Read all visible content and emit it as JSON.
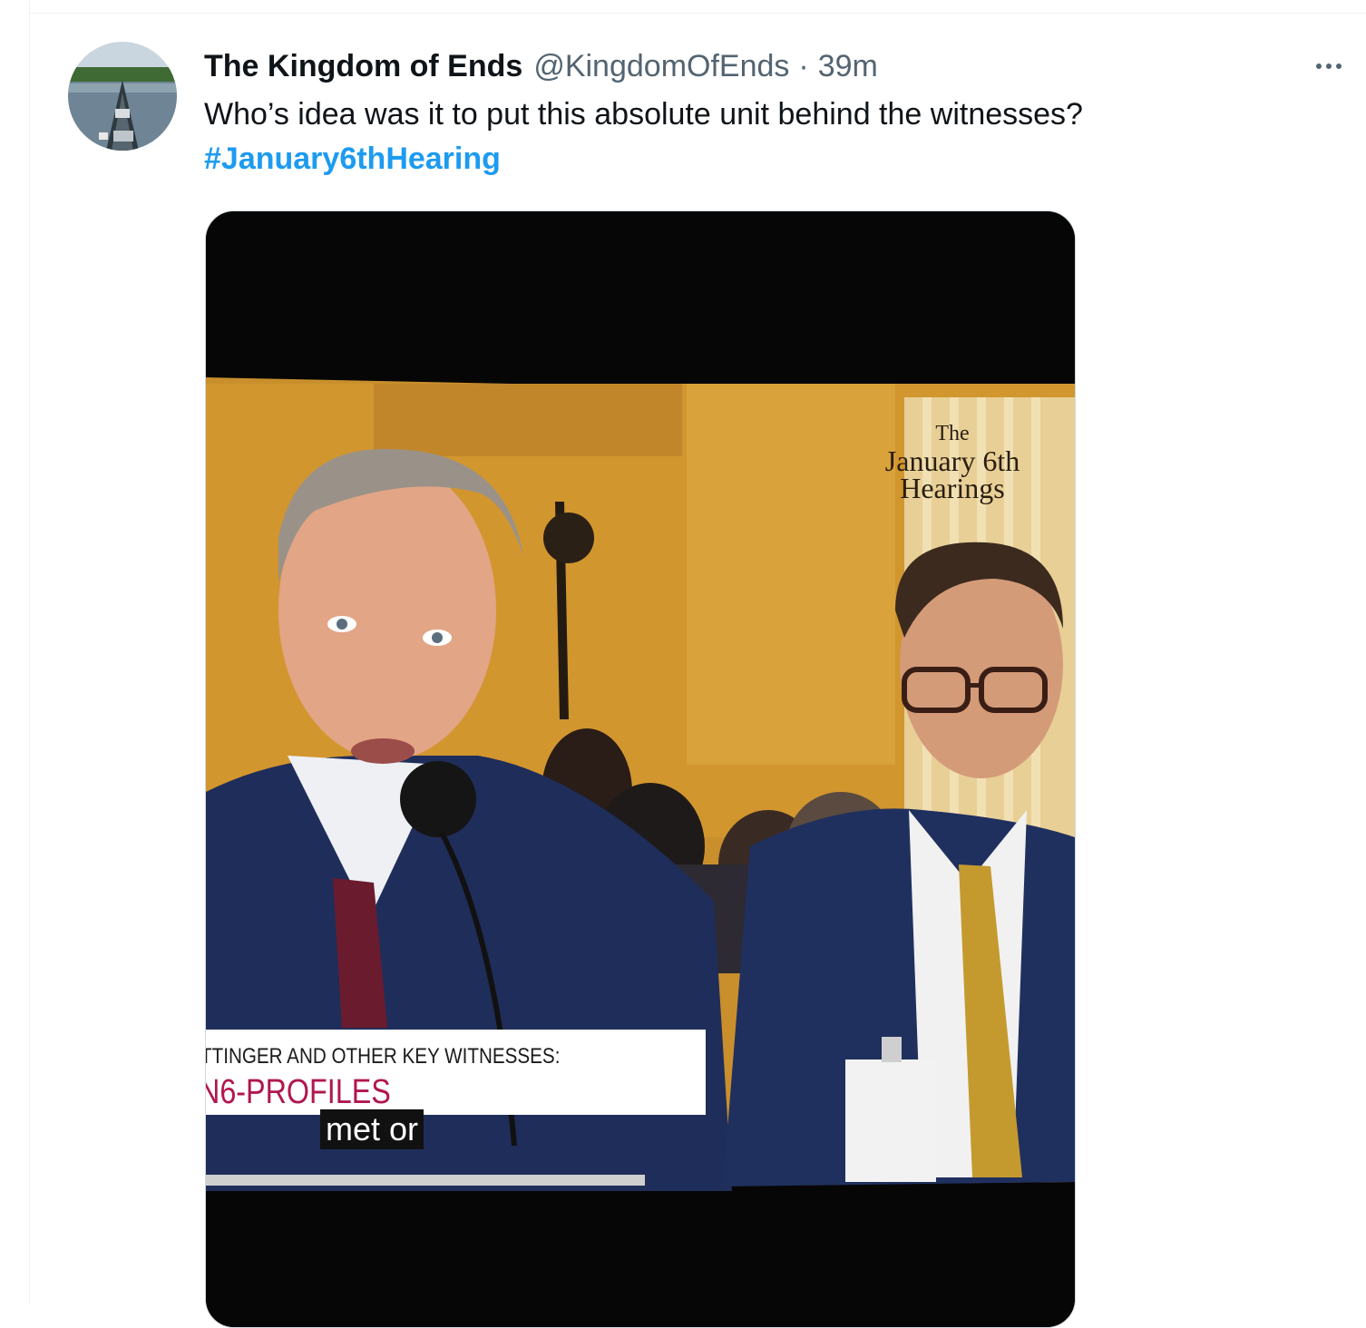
{
  "tweet": {
    "author_name": "The Kingdom of Ends",
    "author_handle": "@KingdomOfEnds",
    "separator": "·",
    "timestamp": "39m",
    "text": "Who’s idea was it to put this absolute unit behind the witnesses?",
    "hashtag": "#January6thHearing",
    "more_icon": "more-horizontal-icon",
    "avatar_icon": "avatar-canoe-lake-photo"
  },
  "media": {
    "description_icon": "hearing-photo",
    "overlay": {
      "line1": "The",
      "line2": "January 6th",
      "line3": "Hearings"
    },
    "chyron": {
      "line1": "TTINGER AND OTHER KEY WITNESSES:",
      "line2": "N6-PROFILES"
    },
    "caption": "met or"
  },
  "colors": {
    "link": "#1d9bf0",
    "secondary_text": "#536471",
    "primary_text": "#0f1419",
    "border": "#cfd9de",
    "chyron_accent": "#b0174e"
  }
}
